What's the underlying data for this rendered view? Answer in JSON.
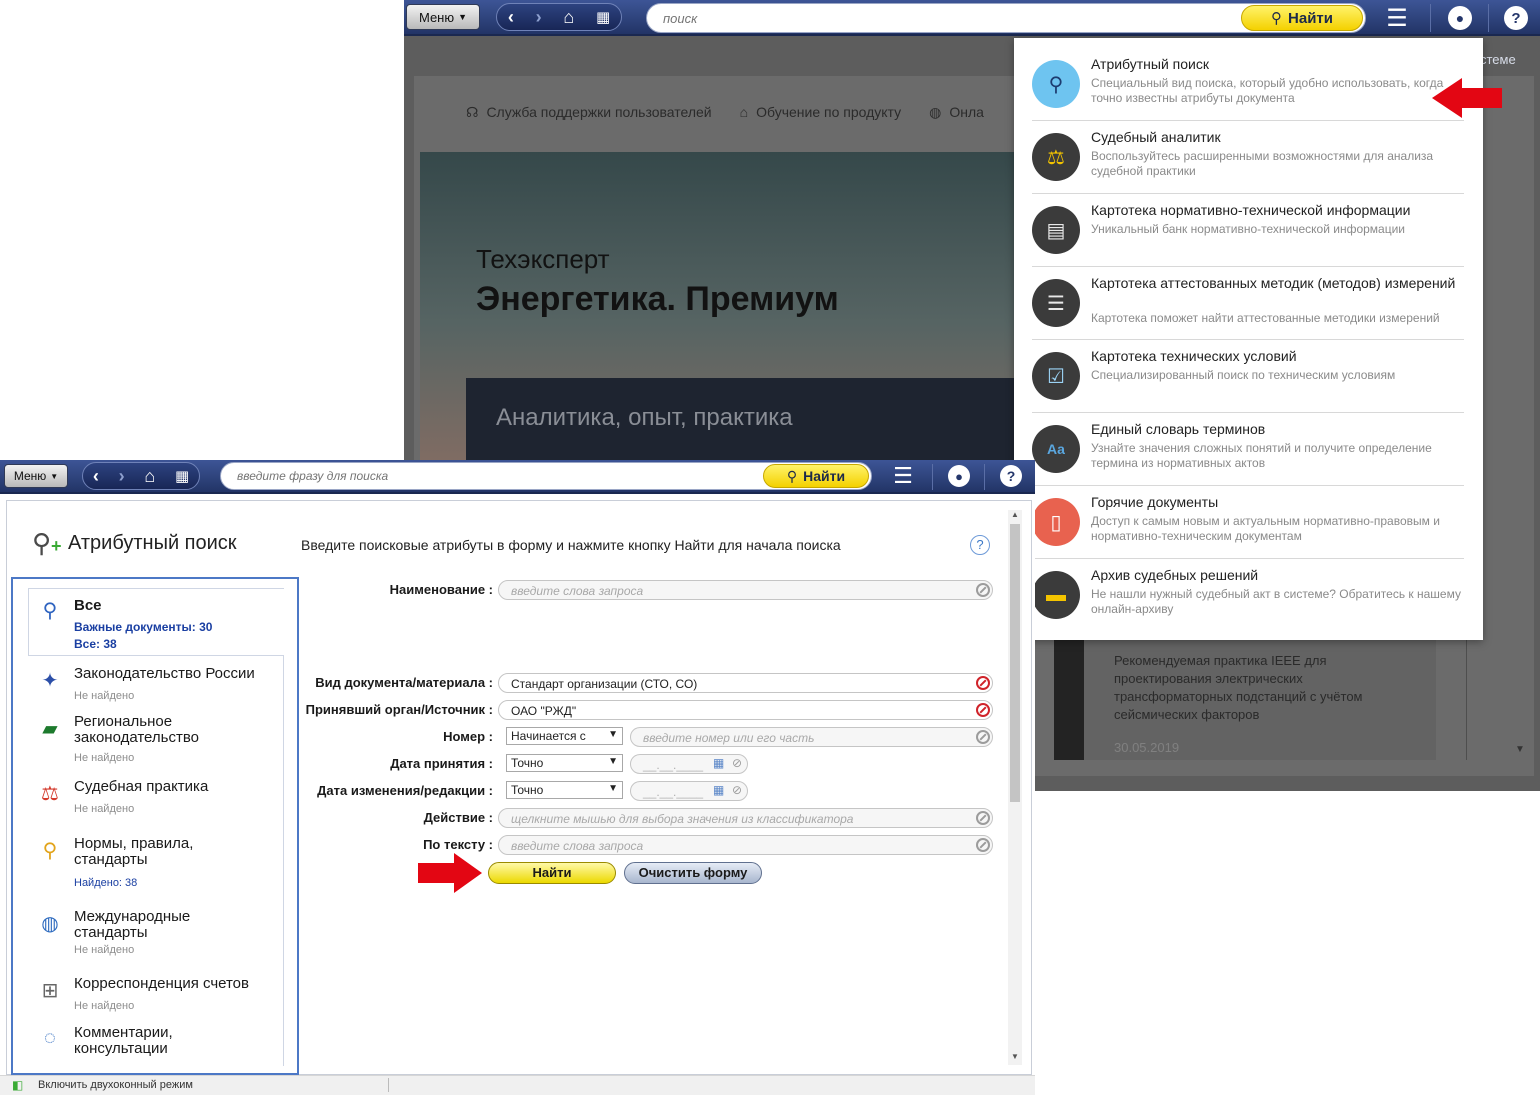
{
  "back_window": {
    "toolbar": {
      "menu_label": "Меню",
      "search_placeholder": "поиск",
      "find_label": "Найти"
    },
    "links": [
      {
        "label": "Служба поддержки пользователей",
        "icon": "headset-icon"
      },
      {
        "label": "Обучение по продукту",
        "icon": "graduation-cap-icon"
      },
      {
        "label": "Онла",
        "icon": "globe-icon"
      }
    ],
    "tab_partial": "стеме",
    "hero": {
      "subtitle": "Техэксперт",
      "title": "Энергетика. Премиум",
      "band": "Аналитика, опыт, практика"
    },
    "news": {
      "text": "Рекомендуемая практика IEEE для проектирования электрических трансформаторных подстанций с учётом сейсмических факторов",
      "date": "30.05.2019"
    }
  },
  "dropdown": {
    "items": [
      {
        "title": "Атрибутный поиск",
        "desc": "Специальный вид поиска, который удобно использовать, когда точно известны атрибуты документа",
        "icon": "attribute-search-icon",
        "color": "#6ec4f0"
      },
      {
        "title": "Судебный аналитик",
        "desc": "Воспользуйтесь расширенными возможностями для анализа судебной практики",
        "icon": "scales-icon",
        "color": "#3b3b3b"
      },
      {
        "title": "Картотека нормативно-технической информации",
        "desc": "Уникальный банк нормативно-технической информации",
        "icon": "card-file-icon",
        "color": "#3b3b3b"
      },
      {
        "title": "Картотека аттестованных методик (методов) измерений",
        "desc": "Картотека поможет найти аттестованные методики измерений",
        "icon": "document-list-icon",
        "color": "#3b3b3b"
      },
      {
        "title": "Картотека технических условий",
        "desc": "Специализированный поиск по техническим условиям",
        "icon": "monitor-check-icon",
        "color": "#3b3b3b"
      },
      {
        "title": "Единый словарь терминов",
        "desc": "Узнайте значения сложных понятий и получите определение термина из нормативных актов",
        "icon": "dictionary-icon",
        "color": "#3b3b3b"
      },
      {
        "title": "Горячие документы",
        "desc": "Доступ к самым новым и актуальным нормативно-правовым и нормативно-техническим документам",
        "icon": "hot-document-icon",
        "color": "#e8624f"
      },
      {
        "title": "Архив судебных решений",
        "desc": "Не нашли нужный судебный акт в системе? Обратитесь к нашему онлайн-архиву",
        "icon": "archive-folder-icon",
        "color": "#3b3b3b"
      }
    ]
  },
  "front_window": {
    "toolbar": {
      "menu_label": "Меню",
      "search_placeholder": "введите фразу для поиска",
      "find_label": "Найти"
    },
    "title": "Атрибутный поиск",
    "instructions": "Введите поисковые атрибуты в форму и нажмите кнопку Найти для начала поиска",
    "help": "?",
    "categories": [
      {
        "name": "Все",
        "stat1": "Важные документы: 30",
        "stat2": "Все: 38",
        "icon": "search-icon"
      },
      {
        "name": "Законодательство России",
        "status": "Не найдено",
        "icon": "russia-emblem-icon"
      },
      {
        "name": "Региональное законодательство",
        "status": "Не найдено",
        "icon": "russia-map-icon"
      },
      {
        "name": "Судебная практика",
        "status": "Не найдено",
        "icon": "scales-icon"
      },
      {
        "name": "Нормы, правила, стандарты",
        "status": "Найдено: 38",
        "icon": "compass-icon"
      },
      {
        "name": "Международные стандарты",
        "status": "Не найдено",
        "icon": "globe-document-icon"
      },
      {
        "name": "Корреспонденция счетов",
        "status": "Не найдено",
        "icon": "accounting-icon"
      },
      {
        "name": "Комментарии, консультации",
        "icon": "chat-bubbles-icon"
      }
    ],
    "form": {
      "name_label": "Наименование :",
      "name_placeholder": "введите слова запроса",
      "doc_type_label": "Вид документа/материала :",
      "doc_type_value": "Стандарт организации (СТО, СО)",
      "source_label": "Принявший орган/Источник :",
      "source_value": "ОАО \"РЖД\"",
      "number_label": "Номер :",
      "number_mode": "Начинается с",
      "number_placeholder": "введите номер или его часть",
      "date_label": "Дата принятия :",
      "date_mode": "Точно",
      "date_mask": "__.__.____",
      "edit_date_label": "Дата изменения/редакции :",
      "edit_date_mode": "Точно",
      "action_label": "Действие :",
      "action_placeholder": "щелкните мышью для выбора значения из классификатора",
      "text_label": "По тексту :",
      "text_placeholder": "введите слова запроса",
      "find_button": "Найти",
      "clear_button": "Очистить форму"
    },
    "status_bar": "Включить двухоконный режим"
  },
  "colors": {
    "toolbar": "#2c3f7a",
    "accent_yellow": "#f4d100",
    "panel_border": "#4c78c6",
    "arrow_red": "#e30613"
  }
}
